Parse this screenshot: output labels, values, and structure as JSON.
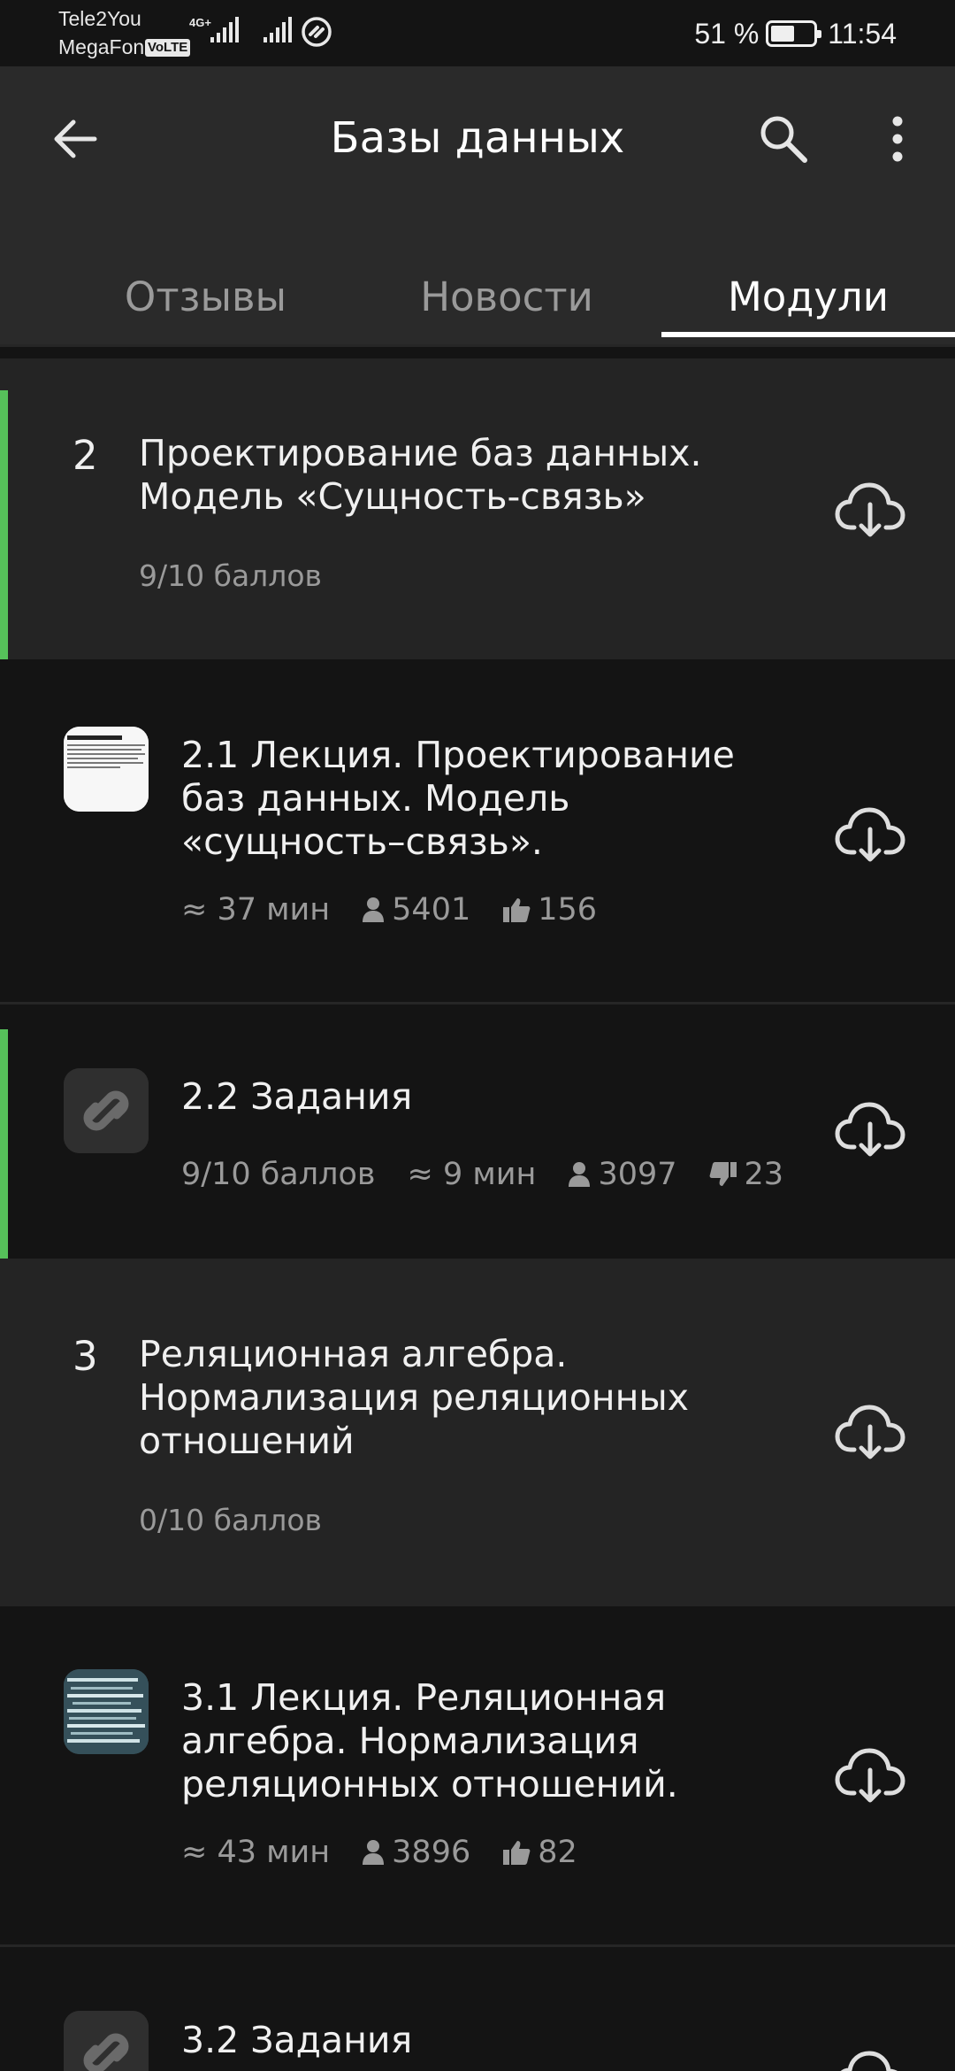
{
  "status_bar": {
    "carrier_1": "Tele2You",
    "carrier_2": "MegaFon",
    "volte": "VoLTE",
    "network": "4G+",
    "battery": "51 %",
    "battery_level": 0.51,
    "time": "11:54"
  },
  "app_bar": {
    "title": "Базы данных"
  },
  "tabs": [
    {
      "label": "Отзывы",
      "active": false
    },
    {
      "label": "Новости",
      "active": false
    },
    {
      "label": "Модули",
      "active": true
    }
  ],
  "sections": [
    {
      "number": "2",
      "title": "Проектирование баз данных. Модель «Сущность-связь»",
      "score": "9/10 баллов",
      "completed": true,
      "lessons": [
        {
          "title": "2.1 Лекция. Проектирование баз данных. Модель «сущность–связь».",
          "duration": "≈ 37 мин",
          "learners": "5401",
          "rating": "156",
          "rating_icon": "thumb-up-icon",
          "thumb_icon": "lecture-thumbnail",
          "completed": false
        },
        {
          "title": "2.2 Задания",
          "score": "9/10 баллов",
          "duration": "≈ 9 мин",
          "learners": "3097",
          "rating": "23",
          "rating_icon": "thumb-down-icon",
          "thumb_icon": "stepik-logo-icon",
          "completed": true
        }
      ]
    },
    {
      "number": "3",
      "title": "Реляционная алгебра. Нормализация реляционных отношений",
      "score": "0/10 баллов",
      "completed": false,
      "lessons": [
        {
          "title": "3.1 Лекция. Реляционная алгебра. Нормализация реляционных отношений.",
          "duration": "≈ 43 мин",
          "learners": "3896",
          "rating": "82",
          "rating_icon": "thumb-up-icon",
          "thumb_icon": "lecture-thumbnail",
          "completed": false
        },
        {
          "title": "3.2 Задания",
          "thumb_icon": "stepik-logo-icon"
        }
      ]
    }
  ],
  "colors": {
    "accent_green": "#56c15a",
    "app_bar": "#2a2a2a",
    "background": "#141414"
  }
}
